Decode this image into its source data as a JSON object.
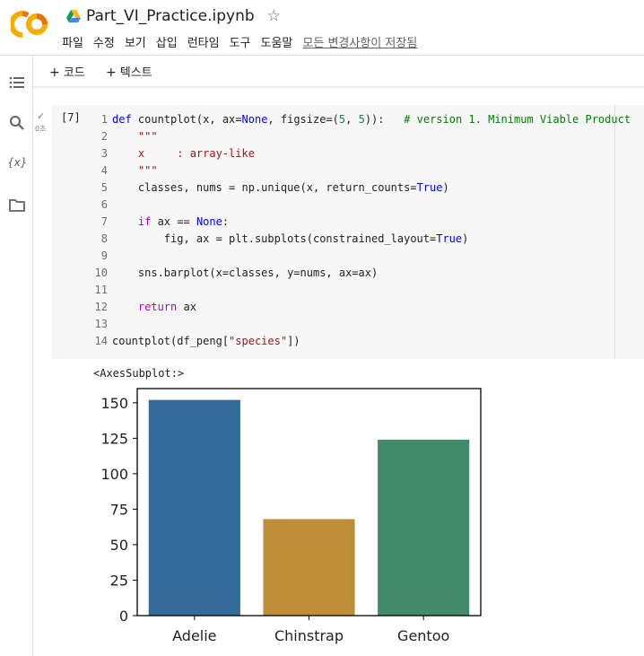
{
  "header": {
    "logo_text": "CO",
    "notebook_title": "Part_VI_Practice.ipynb",
    "menu": [
      "파일",
      "수정",
      "보기",
      "삽입",
      "런타임",
      "도구",
      "도움말"
    ],
    "saved_status": "모든 변경사항이 저장됨"
  },
  "toolbar": {
    "add_code": "코드",
    "add_text": "텍스트",
    "plus": "+"
  },
  "sidebar": {
    "icons": [
      "table-of-contents-icon",
      "search-icon",
      "variables-icon",
      "files-icon"
    ],
    "variables_glyph": "{x}"
  },
  "cell": {
    "exec_count": "[7]",
    "run_time": "0초",
    "status_icon": "✓",
    "lines": [
      {
        "n": "1",
        "t": "def countplot(x, ax=None, figsize=(5, 5)):   # version 1. Minimum Viable Product"
      },
      {
        "n": "2",
        "t": "    \"\"\""
      },
      {
        "n": "3",
        "t": "    x     : array-like"
      },
      {
        "n": "4",
        "t": "    \"\"\""
      },
      {
        "n": "5",
        "t": "    classes, nums = np.unique(x, return_counts=True)"
      },
      {
        "n": "6",
        "t": ""
      },
      {
        "n": "7",
        "t": "    if ax == None:"
      },
      {
        "n": "8",
        "t": "        fig, ax = plt.subplots(constrained_layout=True)"
      },
      {
        "n": "9",
        "t": ""
      },
      {
        "n": "10",
        "t": "    sns.barplot(x=classes, y=nums, ax=ax)"
      },
      {
        "n": "11",
        "t": ""
      },
      {
        "n": "12",
        "t": "    return ax"
      },
      {
        "n": "13",
        "t": ""
      },
      {
        "n": "14",
        "t": "countplot(df_peng[\"species\"])"
      }
    ]
  },
  "output": {
    "repr_text": "<AxesSubplot:>"
  },
  "chart_data": {
    "type": "bar",
    "categories": [
      "Adelie",
      "Chinstrap",
      "Gentoo"
    ],
    "values": [
      152,
      68,
      124
    ],
    "colors": [
      "#3274a1",
      "#e1812c",
      "#3a923a"
    ],
    "display_colors": [
      "#336c9b",
      "#bd8d37",
      "#418a6a"
    ],
    "ylim": [
      0,
      160
    ],
    "yticks": [
      0,
      25,
      50,
      75,
      100,
      125,
      150
    ],
    "title": "",
    "xlabel": "",
    "ylabel": ""
  }
}
